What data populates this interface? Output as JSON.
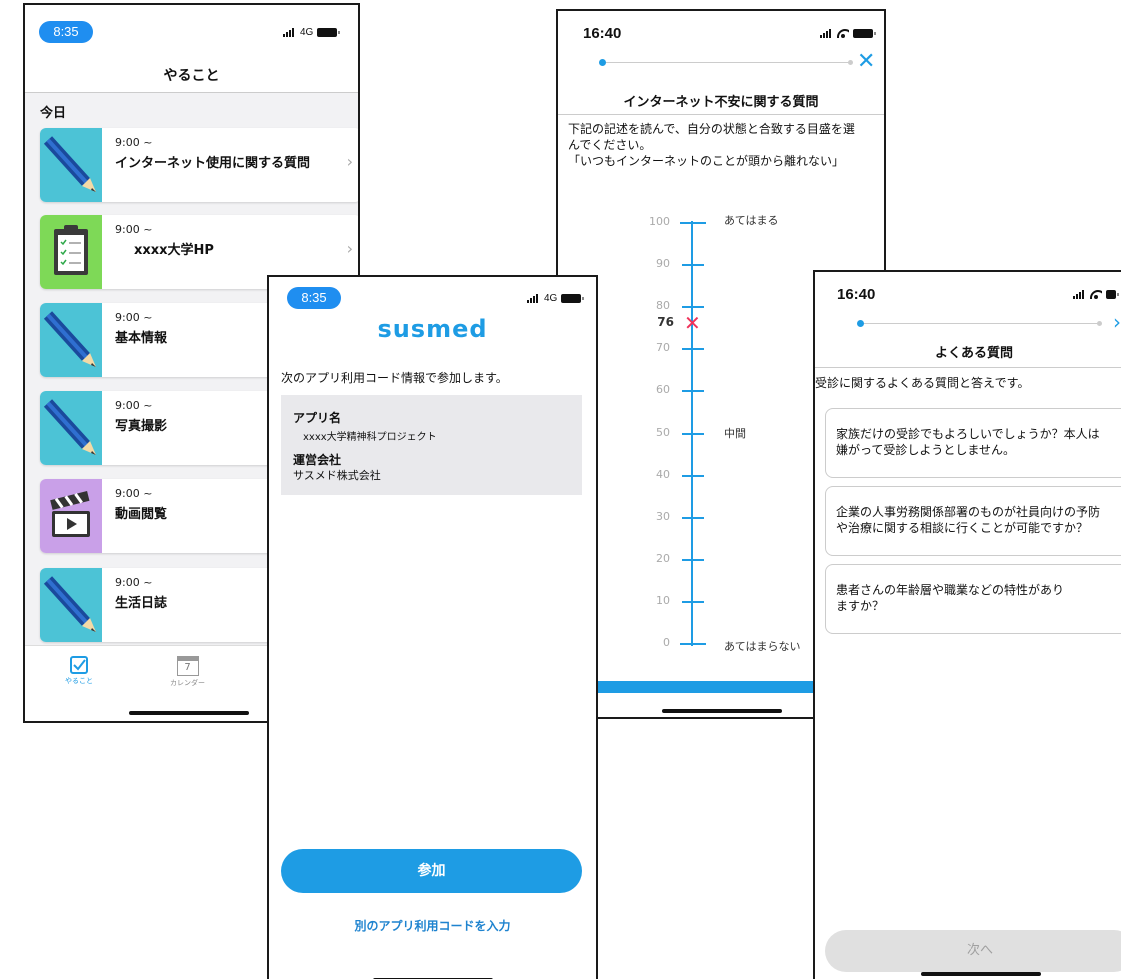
{
  "todo_screen": {
    "status_time": "8:35",
    "network": "4G",
    "title": "やること",
    "section": "今日",
    "tasks": [
      {
        "time": "9:00 ~",
        "name": "インターネット使用に関する質問",
        "icon": "pencil-icon"
      },
      {
        "time": "9:00 ~",
        "name": "xxxx大学HP",
        "icon": "clipboard-icon"
      },
      {
        "time": "9:00 ~",
        "name": "基本情報",
        "icon": "pencil-icon"
      },
      {
        "time": "9:00 ~",
        "name": "写真撮影",
        "icon": "pencil-icon"
      },
      {
        "time": "9:00 ~",
        "name": "動画閲覧",
        "icon": "clapperboard-icon"
      },
      {
        "time": "9:00 ~",
        "name": "生活日誌",
        "icon": "pencil-icon"
      }
    ],
    "tabs": {
      "todo": "やること",
      "calendar_day": "7",
      "calendar": "カレンダー"
    }
  },
  "join_screen": {
    "status_time": "8:35",
    "network": "4G",
    "logo": "susmed",
    "intro": "次のアプリ利用コード情報で参加します。",
    "app_name_label": "アプリ名",
    "app_name": "xxxx大学精神科プロジェクト",
    "company_label": "運営会社",
    "company": "サスメド株式会社",
    "join_button": "参加",
    "alt_code_link": "別のアプリ利用コードを入力"
  },
  "question_screen": {
    "status_time": "16:40",
    "title": "インターネット不安に関する質問",
    "prompt_line1": "下記の記述を読んで、自分の状態と合致する目盛を選",
    "prompt_line2": "んでください。",
    "prompt_line3": "「いつもインターネットのことが頭から離れない」",
    "scale_ticks": [
      "100",
      "90",
      "80",
      "70",
      "60",
      "50",
      "40",
      "30",
      "20",
      "10",
      "0"
    ],
    "anchor_top": "あてはまる",
    "anchor_mid": "中間",
    "anchor_bottom": "あてはまらない",
    "selected_value": "76",
    "selected_fraction": 0.76
  },
  "faq_screen": {
    "status_time": "16:40",
    "title": "よくある質問",
    "intro": "受診に関するよくある質問と答えです。",
    "questions": [
      {
        "line1": "家族だけの受診でもよろしいでしょうか？本人は",
        "line2": "嫌がって受診しようとしません。"
      },
      {
        "line1": "企業の人事労務関係部署のものが社員向けの予防",
        "line2": "や治療に関する相談に行くことが可能ですか？"
      },
      {
        "line1": "患者さんの年齢層や職業などの特性があり",
        "line2": "ますか？"
      }
    ],
    "next_button": "次へ"
  },
  "colors": {
    "accent": "#1e9ce4",
    "marker": "#f0325a",
    "status_pill": "#1f8ef0"
  }
}
